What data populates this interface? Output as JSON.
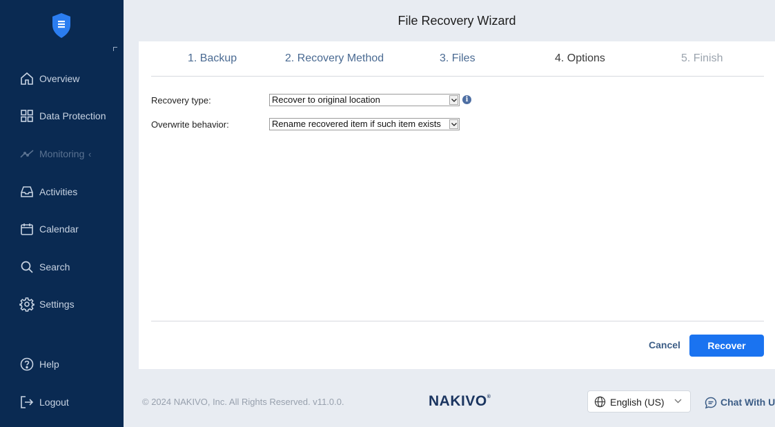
{
  "sidebar": {
    "items": [
      {
        "label": "Overview",
        "icon": "home-icon"
      },
      {
        "label": "Data Protection",
        "icon": "grid-icon"
      },
      {
        "label": "Monitoring",
        "icon": "chart-line-icon",
        "disabled": true
      },
      {
        "label": "Activities",
        "icon": "inbox-icon"
      },
      {
        "label": "Calendar",
        "icon": "calendar-icon"
      },
      {
        "label": "Search",
        "icon": "search-icon"
      },
      {
        "label": "Settings",
        "icon": "gear-icon"
      }
    ],
    "bottom_items": [
      {
        "label": "Help",
        "icon": "help-icon"
      },
      {
        "label": "Logout",
        "icon": "logout-icon"
      }
    ],
    "monitoring_chevron": "‹"
  },
  "wizard": {
    "title": "File Recovery Wizard",
    "steps": [
      "1. Backup",
      "2. Recovery Method",
      "3. Files",
      "4. Options",
      "5. Finish"
    ],
    "active_step": 4
  },
  "form": {
    "recovery_type_label": "Recovery type:",
    "recovery_type_value": "Recover to original location",
    "overwrite_label": "Overwrite behavior:",
    "overwrite_value": "Rename recovered item if such item exists",
    "info_icon_glyph": "i"
  },
  "actions": {
    "cancel": "Cancel",
    "recover": "Recover"
  },
  "footer": {
    "copyright": "© 2024 NAKIVO, Inc. All Rights Reserved. v11.0.0.",
    "brand": "NAKIVO",
    "brand_mark": "®",
    "language": "English (US)",
    "chat": "Chat With Us"
  },
  "colors": {
    "sidebar_bg": "#0a2a52",
    "accent": "#1a73f0",
    "link": "#3c5d86"
  }
}
